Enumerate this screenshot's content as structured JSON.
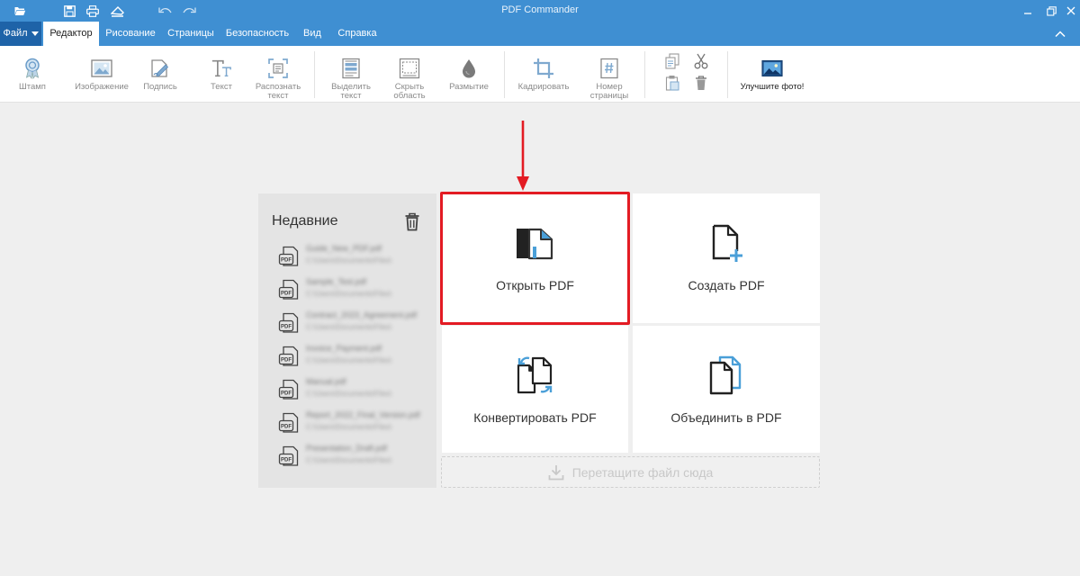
{
  "titlebar": {
    "title": "PDF Commander",
    "quick_access": [
      "open-folder-icon",
      "save-icon",
      "print-icon",
      "scan-icon",
      "undo-icon",
      "redo-icon"
    ]
  },
  "menubar": {
    "file": "Файл",
    "tabs": [
      "Редактор",
      "Рисование",
      "Страницы",
      "Безопасность",
      "Вид",
      "Справка"
    ],
    "active_tab": "Редактор"
  },
  "ribbon": {
    "stamp": "Штамп",
    "image": "Изображение",
    "signature": "Подпись",
    "text": "Текст",
    "ocr": "Распознать\nтекст",
    "select_text": "Выделить\nтекст",
    "hide_area": "Скрыть\nобласть",
    "blur": "Размытие",
    "crop": "Кадрировать",
    "page_number": "Номер\nстраницы",
    "improve_photo": "Улучшите фото!"
  },
  "recent": {
    "title": "Недавние",
    "items": [
      {
        "name": "Guide_New_PDF.pdf",
        "path": "C:\\Users\\Documents\\Files\\"
      },
      {
        "name": "Sample_Test.pdf",
        "path": "C:\\Users\\Documents\\Files\\"
      },
      {
        "name": "Contract_2023_Agreement.pdf",
        "path": "C:\\Users\\Documents\\Files\\"
      },
      {
        "name": "Invoice_Payment.pdf",
        "path": "C:\\Users\\Documents\\Files\\"
      },
      {
        "name": "Manual.pdf",
        "path": "C:\\Users\\Documents\\Files\\"
      },
      {
        "name": "Report_2022_Final_Version.pdf",
        "path": "C:\\Users\\Documents\\Files\\"
      },
      {
        "name": "Presentation_Draft.pdf",
        "path": "C:\\Users\\Documents\\Files\\"
      }
    ]
  },
  "actions": {
    "open": "Открыть PDF",
    "create": "Создать PDF",
    "convert": "Конвертировать PDF",
    "merge": "Объединить в PDF"
  },
  "drop_zone": "Перетащите файл сюда",
  "colors": {
    "accent": "#3f8fd2",
    "file_button": "#1e63a8",
    "highlight": "#e31b23"
  }
}
